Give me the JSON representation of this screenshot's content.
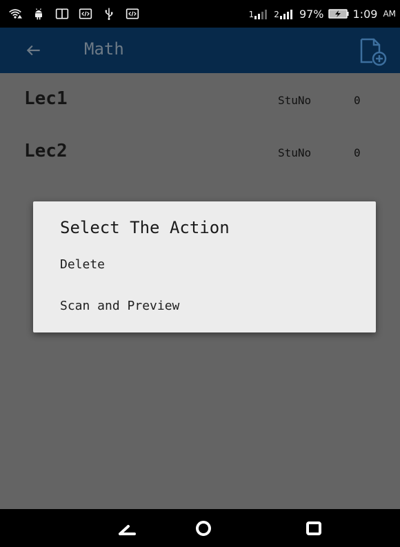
{
  "status_bar": {
    "sim1_label": "1",
    "sim2_label": "2",
    "battery_percent": "97%",
    "time": "1:09",
    "ampm": "AM",
    "icons": [
      "wifi-icon",
      "android-icon",
      "tablet-icon",
      "code-icon",
      "usb-icon",
      "code-icon",
      "signal-icon",
      "battery-charging-icon"
    ]
  },
  "app_bar": {
    "title": "Math",
    "back_icon": "arrow-left-icon",
    "add_icon": "add-file-icon",
    "color": "#07294a"
  },
  "list": {
    "rows": [
      {
        "title": "Lec1",
        "label": "StuNo",
        "value": "0"
      },
      {
        "title": "Lec2",
        "label": "StuNo",
        "value": "0"
      }
    ]
  },
  "dialog": {
    "title": "Select The Action",
    "items": [
      "Delete",
      "Scan and Preview"
    ]
  },
  "nav_bar": {
    "icons": [
      "back-nav-icon",
      "home-nav-icon",
      "recent-apps-icon"
    ]
  }
}
